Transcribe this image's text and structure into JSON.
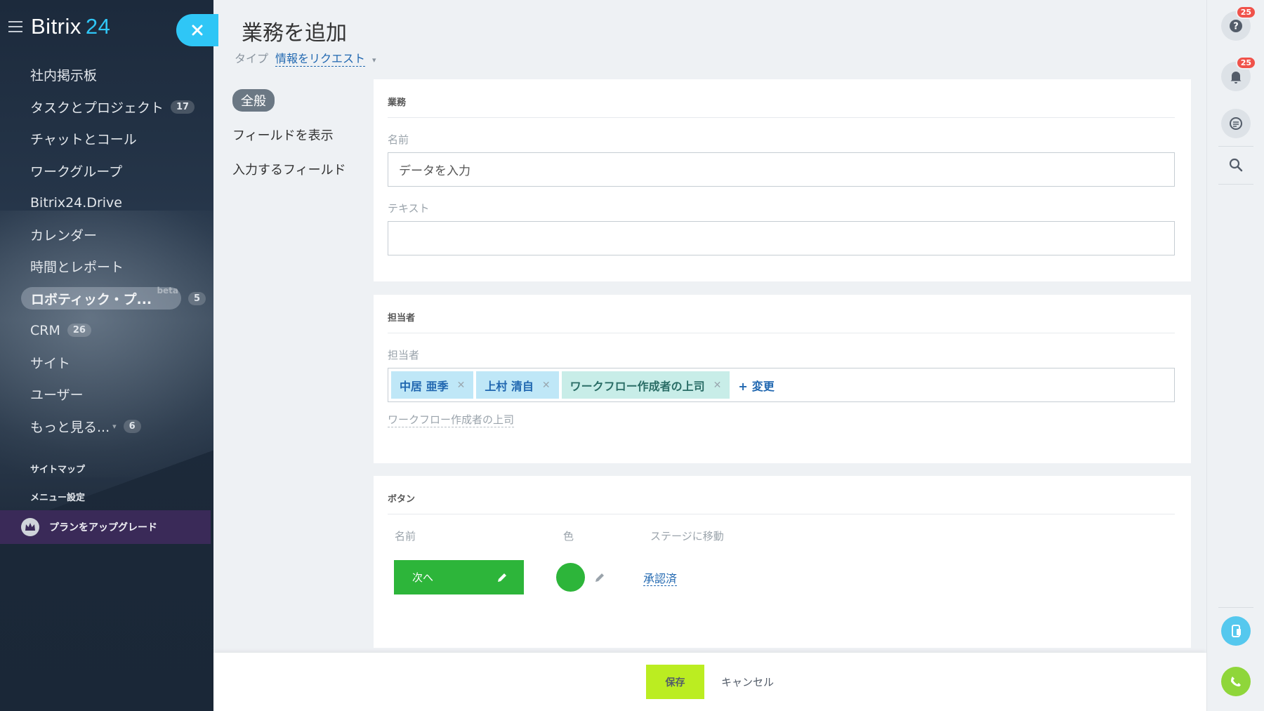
{
  "sidebar": {
    "logo_main": "Bitrix",
    "logo_num": "24",
    "items": [
      {
        "label": "社内掲示板",
        "badge": ""
      },
      {
        "label": "タスクとプロジェクト",
        "badge": "17"
      },
      {
        "label": "チャットとコール",
        "badge": ""
      },
      {
        "label": "ワークグループ",
        "badge": ""
      },
      {
        "label": "Bitrix24.Drive",
        "badge": ""
      },
      {
        "label": "カレンダー",
        "badge": ""
      },
      {
        "label": "時間とレポート",
        "badge": ""
      },
      {
        "label": "ロボティック・プ...",
        "badge": "5",
        "beta": "beta"
      },
      {
        "label": "CRM",
        "badge": "26"
      },
      {
        "label": "サイト",
        "badge": ""
      },
      {
        "label": "ユーザー",
        "badge": ""
      },
      {
        "label": "もっと見る...",
        "badge": "6"
      }
    ],
    "sitemap": "サイトマップ",
    "menu_settings": "メニュー設定",
    "upgrade": "プランをアップグレード"
  },
  "panel": {
    "title": "業務を追加",
    "type_label": "タイプ",
    "type_value": "情報をリクエスト",
    "tabs": [
      "全般",
      "フィールドを表示",
      "入力するフィールド"
    ],
    "task_card": {
      "header": "業務",
      "name_label": "名前",
      "name_value": "データを入力",
      "text_label": "テキスト",
      "text_value": ""
    },
    "assignee_card": {
      "header": "担当者",
      "field_label": "担当者",
      "chips": [
        "中居 亜季",
        "上村 清自",
        "ワークフロー作成者の上司"
      ],
      "change": "変更",
      "link": "ワークフロー作成者の上司"
    },
    "buttons_card": {
      "header": "ボタン",
      "col_name": "名前",
      "col_color": "色",
      "col_stage": "ステージに移動",
      "button_label": "次へ",
      "button_color": "#2db53a",
      "stage": "承認済"
    },
    "save": "保存",
    "cancel": "キャンセル"
  },
  "rail": {
    "help_badge": "25",
    "notif_badge": "25"
  }
}
